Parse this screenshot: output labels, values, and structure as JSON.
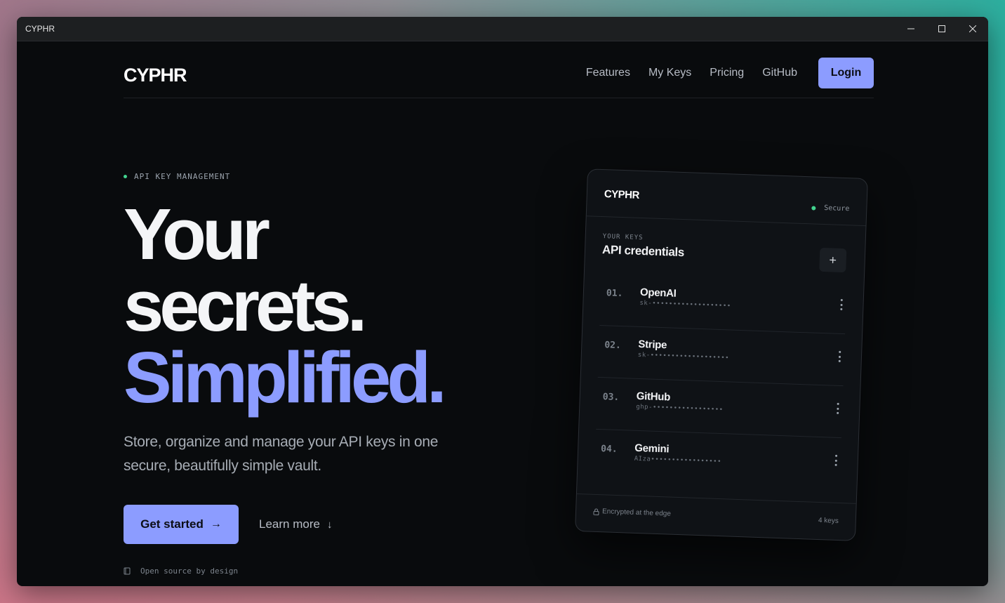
{
  "window": {
    "title": "CYPHR"
  },
  "nav": {
    "logo": "CYPHR",
    "links": [
      "Features",
      "My Keys",
      "Pricing",
      "GitHub"
    ],
    "login": "Login"
  },
  "hero": {
    "eyebrow": "API KEY MANAGEMENT",
    "headline_1": "Your",
    "headline_2": "secrets.",
    "headline_3": "Simplified.",
    "subtitle": "Store, organize and manage your API keys in one secure, beautifully simple vault.",
    "primary_cta": "Get started",
    "secondary_cta": "Learn more",
    "footnote": "Open source by design"
  },
  "card": {
    "logo": "CYPHR",
    "status": "Secure",
    "section_eyebrow": "YOUR KEYS",
    "section_title": "API credentials",
    "add_label": "+",
    "keys": [
      {
        "index": "01.",
        "name": "OpenAI",
        "mask": "sk-•••••••••••••••••••"
      },
      {
        "index": "02.",
        "name": "Stripe",
        "mask": "sk-•••••••••••••••••••"
      },
      {
        "index": "03.",
        "name": "GitHub",
        "mask": "ghp-•••••••••••••••••"
      },
      {
        "index": "04.",
        "name": "Gemini",
        "mask": "AIza•••••••••••••••••"
      }
    ],
    "footer_left": "Encrypted at the edge",
    "footer_right": "4 keys"
  },
  "colors": {
    "accent": "#8c9cff",
    "status_green": "#42d38f",
    "background": "#090b0d"
  },
  "icons": {
    "primary_cta": "arrow-right-icon",
    "secondary_cta": "arrow-down-icon",
    "footnote": "book-icon",
    "card_footer": "lock-icon",
    "key_menu": "more-vertical-icon"
  }
}
